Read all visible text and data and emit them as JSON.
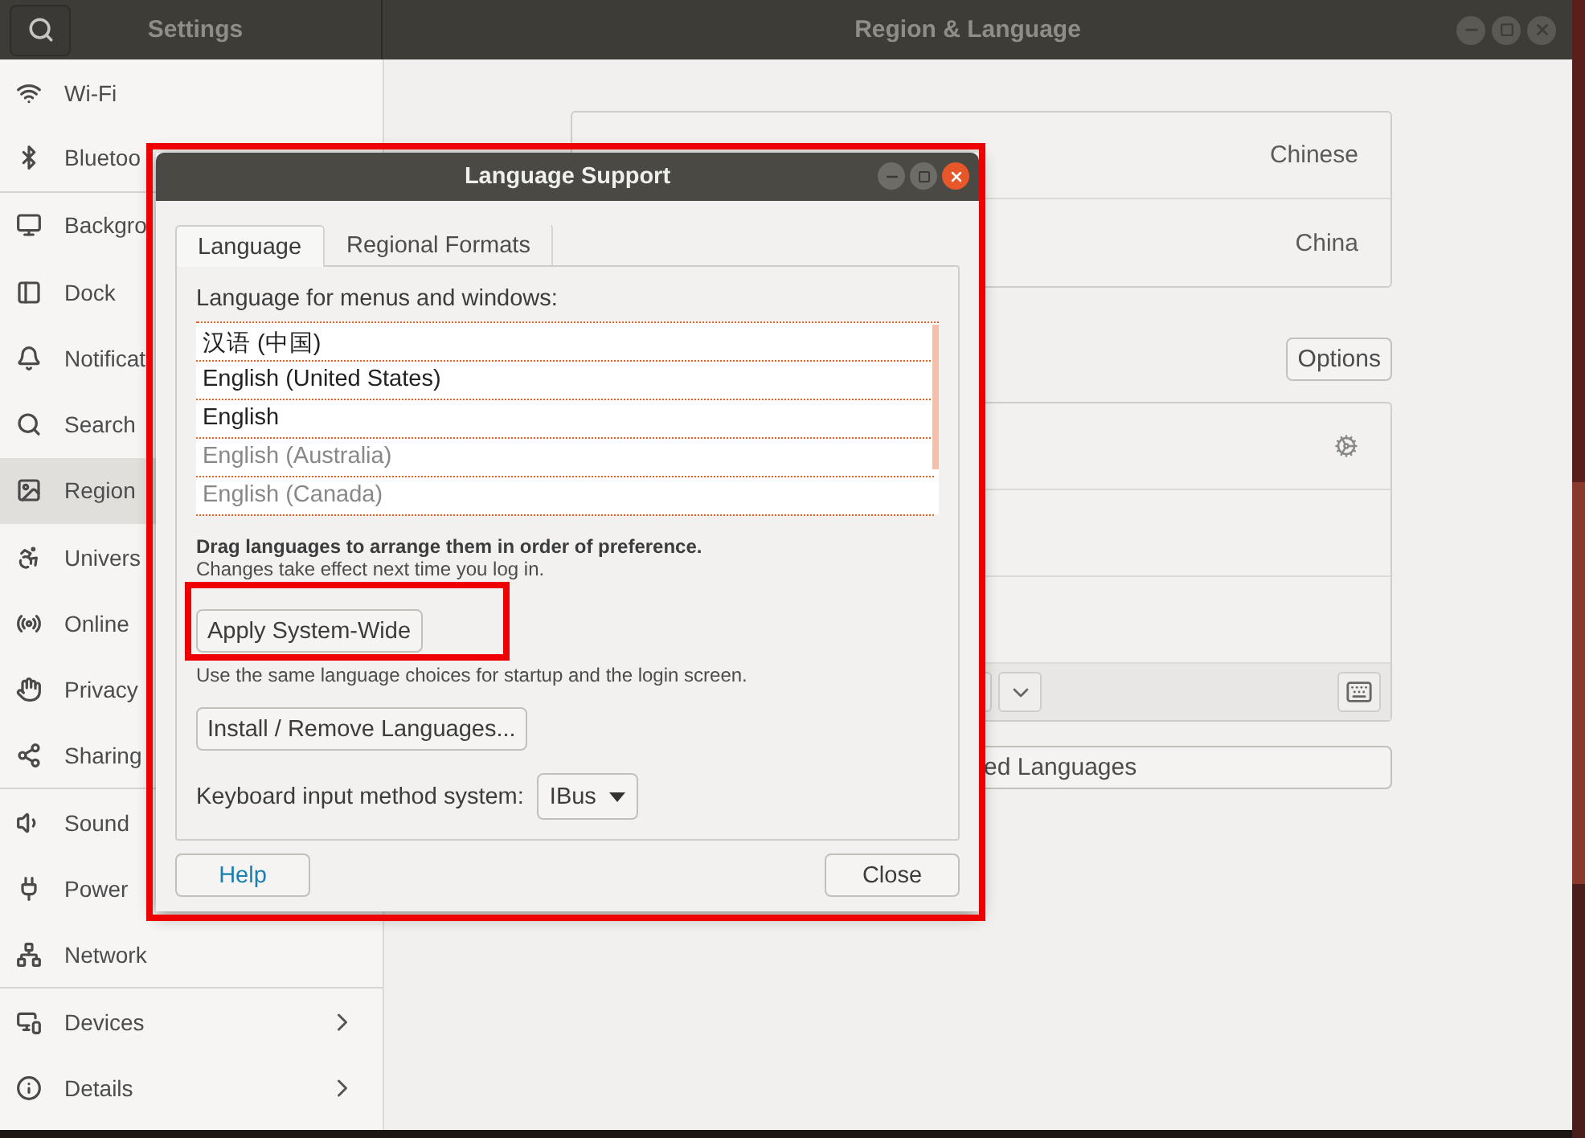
{
  "header": {
    "left_title": "Settings",
    "right_title": "Region & Language"
  },
  "sidebar": {
    "items": [
      {
        "label": "Wi-Fi",
        "selected": false,
        "chevron": false
      },
      {
        "label": "Bluetoo",
        "selected": false,
        "chevron": false
      },
      {
        "label": "Backgro",
        "selected": false,
        "chevron": false
      },
      {
        "label": "Dock",
        "selected": false,
        "chevron": false
      },
      {
        "label": "Notificat",
        "selected": false,
        "chevron": false
      },
      {
        "label": "Search",
        "selected": false,
        "chevron": false
      },
      {
        "label": "Region",
        "selected": true,
        "chevron": false
      },
      {
        "label": "Univers",
        "selected": false,
        "chevron": false
      },
      {
        "label": "Online",
        "selected": false,
        "chevron": false
      },
      {
        "label": "Privacy",
        "selected": false,
        "chevron": false
      },
      {
        "label": "Sharing",
        "selected": false,
        "chevron": false
      },
      {
        "label": "Sound",
        "selected": false,
        "chevron": false
      },
      {
        "label": "Power",
        "selected": false,
        "chevron": false
      },
      {
        "label": "Network",
        "selected": false,
        "chevron": false
      },
      {
        "label": "Devices",
        "selected": false,
        "chevron": true
      },
      {
        "label": "Details",
        "selected": false,
        "chevron": true
      }
    ]
  },
  "region_panel": {
    "language_value": "Chinese",
    "formats_value": "China",
    "options_button": "Options",
    "installed_button": "ed Languages"
  },
  "dialog": {
    "title": "Language Support",
    "highlighted": true,
    "tabs": [
      {
        "label": "Language",
        "selected": true
      },
      {
        "label": "Regional Formats",
        "selected": false
      }
    ],
    "list_label": "Language for menus and windows:",
    "languages": [
      {
        "label": "汉语 (中国)",
        "active": true
      },
      {
        "label": "English (United States)",
        "active": true
      },
      {
        "label": "English",
        "active": true
      },
      {
        "label": "English (Australia)",
        "active": false
      },
      {
        "label": "English (Canada)",
        "active": false
      }
    ],
    "drag_hint": "Drag languages to arrange them in order of preference.",
    "change_note": "Changes take effect next time you log in.",
    "apply_button": {
      "label": "Apply System-Wide",
      "highlighted": true
    },
    "apply_note": "Use the same language choices for startup and the login screen.",
    "install_button": "Install / Remove Languages...",
    "keyboard_label": "Keyboard input method system:",
    "keyboard_value": "IBus",
    "help_button": "Help",
    "close_button": "Close"
  }
}
